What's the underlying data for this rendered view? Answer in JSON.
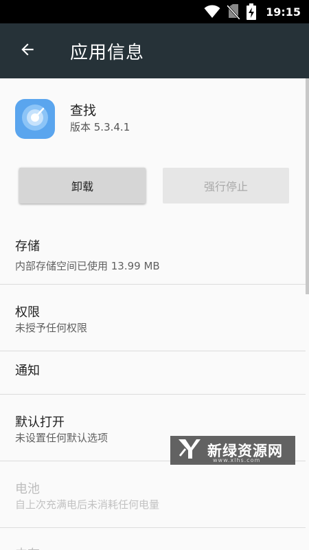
{
  "status_bar": {
    "time": "19:15"
  },
  "app_bar": {
    "title": "应用信息"
  },
  "app": {
    "name": "查找",
    "version": "版本 5.3.4.1",
    "icon_color": "#5aa5ee"
  },
  "buttons": {
    "uninstall": "卸载",
    "force_stop": "强行停止"
  },
  "items": [
    {
      "title": "存储",
      "subtitle": "内部存储空间已使用 13.99 MB"
    },
    {
      "title": "权限",
      "subtitle": "未授予任何权限"
    },
    {
      "title": "通知"
    },
    {
      "title": "默认打开",
      "subtitle": "未设置任何默认选项"
    },
    {
      "title": "电池",
      "subtitle": "自上次充满电后未消耗任何电量"
    },
    {
      "title": "内存"
    }
  ],
  "watermark": {
    "text": "新绿资源网",
    "sub": "www.xlhs.com"
  },
  "colors": {
    "app_bar": "#263238",
    "status_bar": "#000000",
    "background": "#fafafa"
  }
}
